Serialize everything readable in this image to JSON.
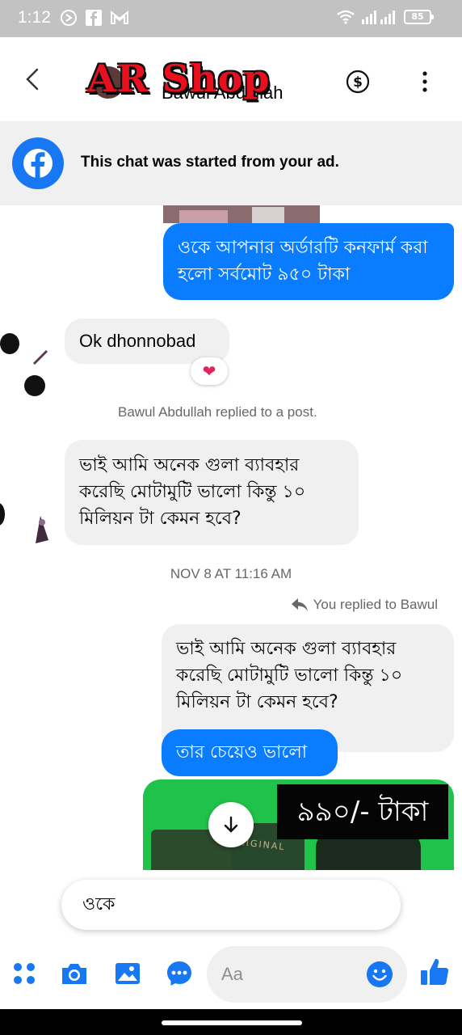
{
  "status_bar": {
    "time": "1:12",
    "battery": "85"
  },
  "header": {
    "contact_name_partial": "Bawul Abdullah",
    "logo_text": "AR Shop",
    "accent_color": "#1877f2"
  },
  "ad_banner": {
    "text": "This chat was started from your ad."
  },
  "messages": {
    "m1": "ওকে আপনার অর্ডারটি কনফার্ম করা হলো সর্বমোট ৯৫০ টাকা",
    "m2": "Ok dhonnobad",
    "m2_reaction": "❤",
    "note1": "Bawul Abdullah replied to a post.",
    "m3": "ভাই আমি অনেক গুলা ব্যাবহার করেছি মোটামুটি ভালো কিন্তু ১০ মিলিয়ন টা কেমন হবে?",
    "timestamp": "NOV 8 AT 11:16 AM",
    "replied_label": "You replied to Bawul",
    "m4_quoted": "ভাই আমি অনেক গুলা ব্যাবহার করেছি মোটামুটি ভালো কিন্তু ১০ মিলিয়ন টা কেমন হবে?",
    "m5": "তার চেয়েও ভালো",
    "image_price": "৯৯০/- টাকা",
    "image_label": "RIGINAL"
  },
  "suggestion": {
    "text": "ওকে"
  },
  "composer": {
    "placeholder": "Aa"
  },
  "icons": [
    "back-arrow-icon",
    "dollar-icon",
    "more-vert-icon",
    "facebook-icon",
    "reply-icon",
    "down-arrow-icon",
    "apps-icon",
    "camera-icon",
    "gallery-icon",
    "chat-bubble-icon",
    "emoji-icon",
    "thumbs-up-icon"
  ]
}
